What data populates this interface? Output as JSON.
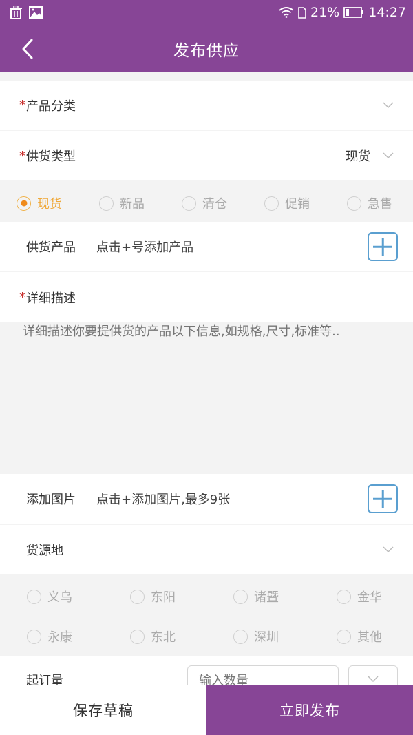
{
  "status_bar": {
    "left_icons": [
      "trash-icon",
      "image-icon"
    ],
    "battery_percent": "21%",
    "time": "14:27"
  },
  "header": {
    "title": "发布供应",
    "back_icon": "chevron-left-icon"
  },
  "form": {
    "product_category": {
      "required_mark": "*",
      "label": "产品分类",
      "value": ""
    },
    "supply_type": {
      "required_mark": "*",
      "label": "供货类型",
      "value": "现货"
    },
    "supply_type_options": [
      {
        "label": "现货",
        "checked": true
      },
      {
        "label": "新品",
        "checked": false
      },
      {
        "label": "清仓",
        "checked": false
      },
      {
        "label": "促销",
        "checked": false
      },
      {
        "label": "急售",
        "checked": false
      }
    ],
    "supply_product": {
      "label": "供货产品",
      "hint": "点击+号添加产品"
    },
    "description": {
      "required_mark": "*",
      "label": "详细描述",
      "placeholder": "详细描述你要提供货的产品以下信息,如规格,尺寸,标准等.."
    },
    "add_images": {
      "label": "添加图片",
      "hint": "点击+添加图片,最多9张"
    },
    "origin": {
      "label": "货源地",
      "value": ""
    },
    "origin_options": [
      {
        "label": "义乌",
        "checked": false
      },
      {
        "label": "东阳",
        "checked": false
      },
      {
        "label": "诸暨",
        "checked": false
      },
      {
        "label": "金华",
        "checked": false
      },
      {
        "label": "永康",
        "checked": false
      },
      {
        "label": "东北",
        "checked": false
      },
      {
        "label": "深圳",
        "checked": false
      },
      {
        "label": "其他",
        "checked": false
      }
    ],
    "moq": {
      "label": "起订量",
      "placeholder": "输入数量",
      "value": ""
    }
  },
  "footer": {
    "save_draft": "保存草稿",
    "publish_now": "立即发布"
  },
  "colors": {
    "brand": "#874596",
    "required": "#c8312f",
    "radio_checked": "#ef8a1a",
    "plus_button": "#5a9fd0"
  }
}
